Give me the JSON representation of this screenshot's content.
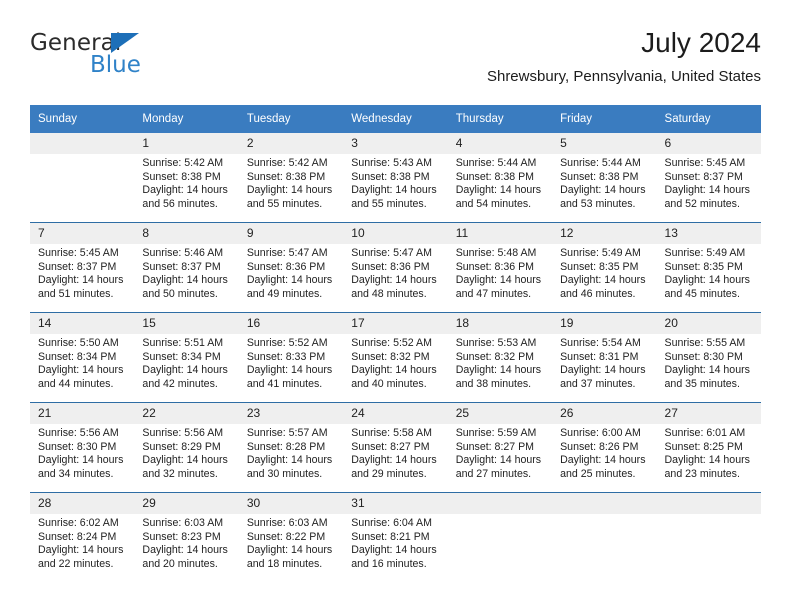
{
  "logo": {
    "word_general": "General",
    "word_blue": "Blue",
    "triangle_color": "#1d6fb8",
    "blue_color": "#2f82c8"
  },
  "header": {
    "title": "July 2024",
    "subtitle": "Shrewsbury, Pennsylvania, United States"
  },
  "theme": {
    "header_blue": "#3a7cc0",
    "row_divider_blue": "#2e6da4",
    "daynum_band": "#efefef"
  },
  "weekdays": [
    "Sunday",
    "Monday",
    "Tuesday",
    "Wednesday",
    "Thursday",
    "Friday",
    "Saturday"
  ],
  "weeks": [
    [
      {
        "day": "",
        "sunrise": "",
        "sunset": "",
        "daylight1": "",
        "daylight2": ""
      },
      {
        "day": "1",
        "sunrise": "Sunrise: 5:42 AM",
        "sunset": "Sunset: 8:38 PM",
        "daylight1": "Daylight: 14 hours",
        "daylight2": "and 56 minutes."
      },
      {
        "day": "2",
        "sunrise": "Sunrise: 5:42 AM",
        "sunset": "Sunset: 8:38 PM",
        "daylight1": "Daylight: 14 hours",
        "daylight2": "and 55 minutes."
      },
      {
        "day": "3",
        "sunrise": "Sunrise: 5:43 AM",
        "sunset": "Sunset: 8:38 PM",
        "daylight1": "Daylight: 14 hours",
        "daylight2": "and 55 minutes."
      },
      {
        "day": "4",
        "sunrise": "Sunrise: 5:44 AM",
        "sunset": "Sunset: 8:38 PM",
        "daylight1": "Daylight: 14 hours",
        "daylight2": "and 54 minutes."
      },
      {
        "day": "5",
        "sunrise": "Sunrise: 5:44 AM",
        "sunset": "Sunset: 8:38 PM",
        "daylight1": "Daylight: 14 hours",
        "daylight2": "and 53 minutes."
      },
      {
        "day": "6",
        "sunrise": "Sunrise: 5:45 AM",
        "sunset": "Sunset: 8:37 PM",
        "daylight1": "Daylight: 14 hours",
        "daylight2": "and 52 minutes."
      }
    ],
    [
      {
        "day": "7",
        "sunrise": "Sunrise: 5:45 AM",
        "sunset": "Sunset: 8:37 PM",
        "daylight1": "Daylight: 14 hours",
        "daylight2": "and 51 minutes."
      },
      {
        "day": "8",
        "sunrise": "Sunrise: 5:46 AM",
        "sunset": "Sunset: 8:37 PM",
        "daylight1": "Daylight: 14 hours",
        "daylight2": "and 50 minutes."
      },
      {
        "day": "9",
        "sunrise": "Sunrise: 5:47 AM",
        "sunset": "Sunset: 8:36 PM",
        "daylight1": "Daylight: 14 hours",
        "daylight2": "and 49 minutes."
      },
      {
        "day": "10",
        "sunrise": "Sunrise: 5:47 AM",
        "sunset": "Sunset: 8:36 PM",
        "daylight1": "Daylight: 14 hours",
        "daylight2": "and 48 minutes."
      },
      {
        "day": "11",
        "sunrise": "Sunrise: 5:48 AM",
        "sunset": "Sunset: 8:36 PM",
        "daylight1": "Daylight: 14 hours",
        "daylight2": "and 47 minutes."
      },
      {
        "day": "12",
        "sunrise": "Sunrise: 5:49 AM",
        "sunset": "Sunset: 8:35 PM",
        "daylight1": "Daylight: 14 hours",
        "daylight2": "and 46 minutes."
      },
      {
        "day": "13",
        "sunrise": "Sunrise: 5:49 AM",
        "sunset": "Sunset: 8:35 PM",
        "daylight1": "Daylight: 14 hours",
        "daylight2": "and 45 minutes."
      }
    ],
    [
      {
        "day": "14",
        "sunrise": "Sunrise: 5:50 AM",
        "sunset": "Sunset: 8:34 PM",
        "daylight1": "Daylight: 14 hours",
        "daylight2": "and 44 minutes."
      },
      {
        "day": "15",
        "sunrise": "Sunrise: 5:51 AM",
        "sunset": "Sunset: 8:34 PM",
        "daylight1": "Daylight: 14 hours",
        "daylight2": "and 42 minutes."
      },
      {
        "day": "16",
        "sunrise": "Sunrise: 5:52 AM",
        "sunset": "Sunset: 8:33 PM",
        "daylight1": "Daylight: 14 hours",
        "daylight2": "and 41 minutes."
      },
      {
        "day": "17",
        "sunrise": "Sunrise: 5:52 AM",
        "sunset": "Sunset: 8:32 PM",
        "daylight1": "Daylight: 14 hours",
        "daylight2": "and 40 minutes."
      },
      {
        "day": "18",
        "sunrise": "Sunrise: 5:53 AM",
        "sunset": "Sunset: 8:32 PM",
        "daylight1": "Daylight: 14 hours",
        "daylight2": "and 38 minutes."
      },
      {
        "day": "19",
        "sunrise": "Sunrise: 5:54 AM",
        "sunset": "Sunset: 8:31 PM",
        "daylight1": "Daylight: 14 hours",
        "daylight2": "and 37 minutes."
      },
      {
        "day": "20",
        "sunrise": "Sunrise: 5:55 AM",
        "sunset": "Sunset: 8:30 PM",
        "daylight1": "Daylight: 14 hours",
        "daylight2": "and 35 minutes."
      }
    ],
    [
      {
        "day": "21",
        "sunrise": "Sunrise: 5:56 AM",
        "sunset": "Sunset: 8:30 PM",
        "daylight1": "Daylight: 14 hours",
        "daylight2": "and 34 minutes."
      },
      {
        "day": "22",
        "sunrise": "Sunrise: 5:56 AM",
        "sunset": "Sunset: 8:29 PM",
        "daylight1": "Daylight: 14 hours",
        "daylight2": "and 32 minutes."
      },
      {
        "day": "23",
        "sunrise": "Sunrise: 5:57 AM",
        "sunset": "Sunset: 8:28 PM",
        "daylight1": "Daylight: 14 hours",
        "daylight2": "and 30 minutes."
      },
      {
        "day": "24",
        "sunrise": "Sunrise: 5:58 AM",
        "sunset": "Sunset: 8:27 PM",
        "daylight1": "Daylight: 14 hours",
        "daylight2": "and 29 minutes."
      },
      {
        "day": "25",
        "sunrise": "Sunrise: 5:59 AM",
        "sunset": "Sunset: 8:27 PM",
        "daylight1": "Daylight: 14 hours",
        "daylight2": "and 27 minutes."
      },
      {
        "day": "26",
        "sunrise": "Sunrise: 6:00 AM",
        "sunset": "Sunset: 8:26 PM",
        "daylight1": "Daylight: 14 hours",
        "daylight2": "and 25 minutes."
      },
      {
        "day": "27",
        "sunrise": "Sunrise: 6:01 AM",
        "sunset": "Sunset: 8:25 PM",
        "daylight1": "Daylight: 14 hours",
        "daylight2": "and 23 minutes."
      }
    ],
    [
      {
        "day": "28",
        "sunrise": "Sunrise: 6:02 AM",
        "sunset": "Sunset: 8:24 PM",
        "daylight1": "Daylight: 14 hours",
        "daylight2": "and 22 minutes."
      },
      {
        "day": "29",
        "sunrise": "Sunrise: 6:03 AM",
        "sunset": "Sunset: 8:23 PM",
        "daylight1": "Daylight: 14 hours",
        "daylight2": "and 20 minutes."
      },
      {
        "day": "30",
        "sunrise": "Sunrise: 6:03 AM",
        "sunset": "Sunset: 8:22 PM",
        "daylight1": "Daylight: 14 hours",
        "daylight2": "and 18 minutes."
      },
      {
        "day": "31",
        "sunrise": "Sunrise: 6:04 AM",
        "sunset": "Sunset: 8:21 PM",
        "daylight1": "Daylight: 14 hours",
        "daylight2": "and 16 minutes."
      },
      {
        "day": "",
        "sunrise": "",
        "sunset": "",
        "daylight1": "",
        "daylight2": ""
      },
      {
        "day": "",
        "sunrise": "",
        "sunset": "",
        "daylight1": "",
        "daylight2": ""
      },
      {
        "day": "",
        "sunrise": "",
        "sunset": "",
        "daylight1": "",
        "daylight2": ""
      }
    ]
  ]
}
